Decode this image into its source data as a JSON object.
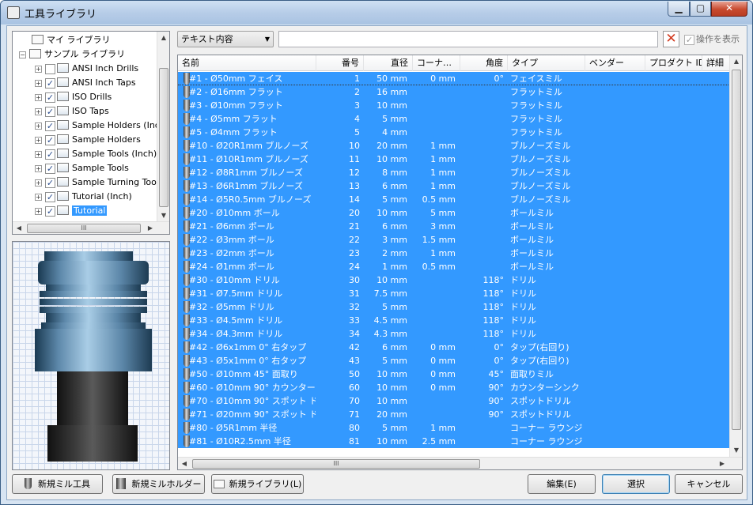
{
  "window": {
    "title": "工具ライブラリ",
    "min": "▁",
    "max": "▢",
    "close": "✕"
  },
  "tree": {
    "items": [
      {
        "label": "マイ ライブラリ",
        "checked": false
      },
      {
        "label": "サンプル ライブラリ",
        "checked": false
      },
      {
        "label": "ANSI Inch Drills",
        "checked": false
      },
      {
        "label": "ANSI Inch Taps",
        "checked": true
      },
      {
        "label": "ISO Drills",
        "checked": true
      },
      {
        "label": "ISO Taps",
        "checked": true
      },
      {
        "label": "Sample Holders (Inch)",
        "checked": true
      },
      {
        "label": "Sample Holders",
        "checked": true
      },
      {
        "label": "Sample Tools (Inch)",
        "checked": true
      },
      {
        "label": "Sample Tools",
        "checked": true
      },
      {
        "label": "Sample Turning Tools",
        "checked": true
      },
      {
        "label": "Tutorial (Inch)",
        "checked": true
      },
      {
        "label": "Tutorial",
        "checked": true,
        "selected": true
      }
    ],
    "hscroll_grip": "III"
  },
  "filter": {
    "field": "テキスト内容",
    "search_value": "",
    "show_ops_label": "操作を表示",
    "show_ops_checked": true
  },
  "grid": {
    "columns": [
      "名前",
      "番号",
      "直径",
      "コーナ…",
      "角度",
      "タイプ",
      "ベンダー",
      "プロダクト ID",
      "詳細"
    ],
    "rows": [
      [
        "#1 - Ø50mm フェイス",
        "1",
        "50 mm",
        "0 mm",
        "0°",
        "フェイスミル"
      ],
      [
        "#2 - Ø16mm フラット",
        "2",
        "16 mm",
        "",
        "",
        "フラットミル"
      ],
      [
        "#3 - Ø10mm フラット",
        "3",
        "10 mm",
        "",
        "",
        "フラットミル"
      ],
      [
        "#4 - Ø5mm フラット",
        "4",
        "5 mm",
        "",
        "",
        "フラットミル"
      ],
      [
        "#5 - Ø4mm フラット",
        "5",
        "4 mm",
        "",
        "",
        "フラットミル"
      ],
      [
        "#10 - Ø20R1mm ブルノーズ",
        "10",
        "20 mm",
        "1 mm",
        "",
        "ブルノーズミル"
      ],
      [
        "#11 - Ø10R1mm ブルノーズ",
        "11",
        "10 mm",
        "1 mm",
        "",
        "ブルノーズミル"
      ],
      [
        "#12 - Ø8R1mm ブルノーズ",
        "12",
        "8 mm",
        "1 mm",
        "",
        "ブルノーズミル"
      ],
      [
        "#13 - Ø6R1mm ブルノーズ",
        "13",
        "6 mm",
        "1 mm",
        "",
        "ブルノーズミル"
      ],
      [
        "#14 - Ø5R0.5mm ブルノーズ",
        "14",
        "5 mm",
        "0.5 mm",
        "",
        "ブルノーズミル"
      ],
      [
        "#20 - Ø10mm ボール",
        "20",
        "10 mm",
        "5 mm",
        "",
        "ボールミル"
      ],
      [
        "#21 - Ø6mm ボール",
        "21",
        "6 mm",
        "3 mm",
        "",
        "ボールミル"
      ],
      [
        "#22 - Ø3mm ボール",
        "22",
        "3 mm",
        "1.5 mm",
        "",
        "ボールミル"
      ],
      [
        "#23 - Ø2mm ボール",
        "23",
        "2 mm",
        "1 mm",
        "",
        "ボールミル"
      ],
      [
        "#24 - Ø1mm ボール",
        "24",
        "1 mm",
        "0.5 mm",
        "",
        "ボールミル"
      ],
      [
        "#30 - Ø10mm ドリル",
        "30",
        "10 mm",
        "",
        "118°",
        "ドリル"
      ],
      [
        "#31 - Ø7.5mm ドリル",
        "31",
        "7.5 mm",
        "",
        "118°",
        "ドリル"
      ],
      [
        "#32 - Ø5mm ドリル",
        "32",
        "5 mm",
        "",
        "118°",
        "ドリル"
      ],
      [
        "#33 - Ø4.5mm ドリル",
        "33",
        "4.5 mm",
        "",
        "118°",
        "ドリル"
      ],
      [
        "#34 - Ø4.3mm ドリル",
        "34",
        "4.3 mm",
        "",
        "118°",
        "ドリル"
      ],
      [
        "#42 - Ø6x1mm 0° 右タップ",
        "42",
        "6 mm",
        "0 mm",
        "0°",
        "タップ(右回り)"
      ],
      [
        "#43 - Ø5x1mm 0° 右タップ",
        "43",
        "5 mm",
        "0 mm",
        "0°",
        "タップ(右回り)"
      ],
      [
        "#50 - Ø10mm 45° 面取り",
        "50",
        "10 mm",
        "0 mm",
        "45°",
        "面取りミル"
      ],
      [
        "#60 - Ø10mm 90° カウンター …",
        "60",
        "10 mm",
        "0 mm",
        "90°",
        "カウンターシンク"
      ],
      [
        "#70 - Ø10mm 90° スポット ド…",
        "70",
        "10 mm",
        "",
        "90°",
        "スポットドリル"
      ],
      [
        "#71 - Ø20mm 90° スポット ド…",
        "71",
        "20 mm",
        "",
        "90°",
        "スポットドリル"
      ],
      [
        "#80 - Ø5R1mm 半径",
        "80",
        "5 mm",
        "1 mm",
        "",
        "コーナー ラウンジ"
      ],
      [
        "#81 - Ø10R2.5mm 半径",
        "81",
        "10 mm",
        "2.5 mm",
        "",
        "コーナー ラウンジ"
      ]
    ],
    "hscroll_grip": "III"
  },
  "buttons": {
    "new_mill_tool": "新規ミル工具",
    "new_mill_holder": "新規ミルホルダー",
    "new_library": "新規ライブラリ(L)",
    "edit": "編集(E)",
    "select": "選択",
    "cancel": "キャンセル"
  },
  "colors": {
    "selection": "#3399ff",
    "accent_x": "#d23b1f"
  }
}
